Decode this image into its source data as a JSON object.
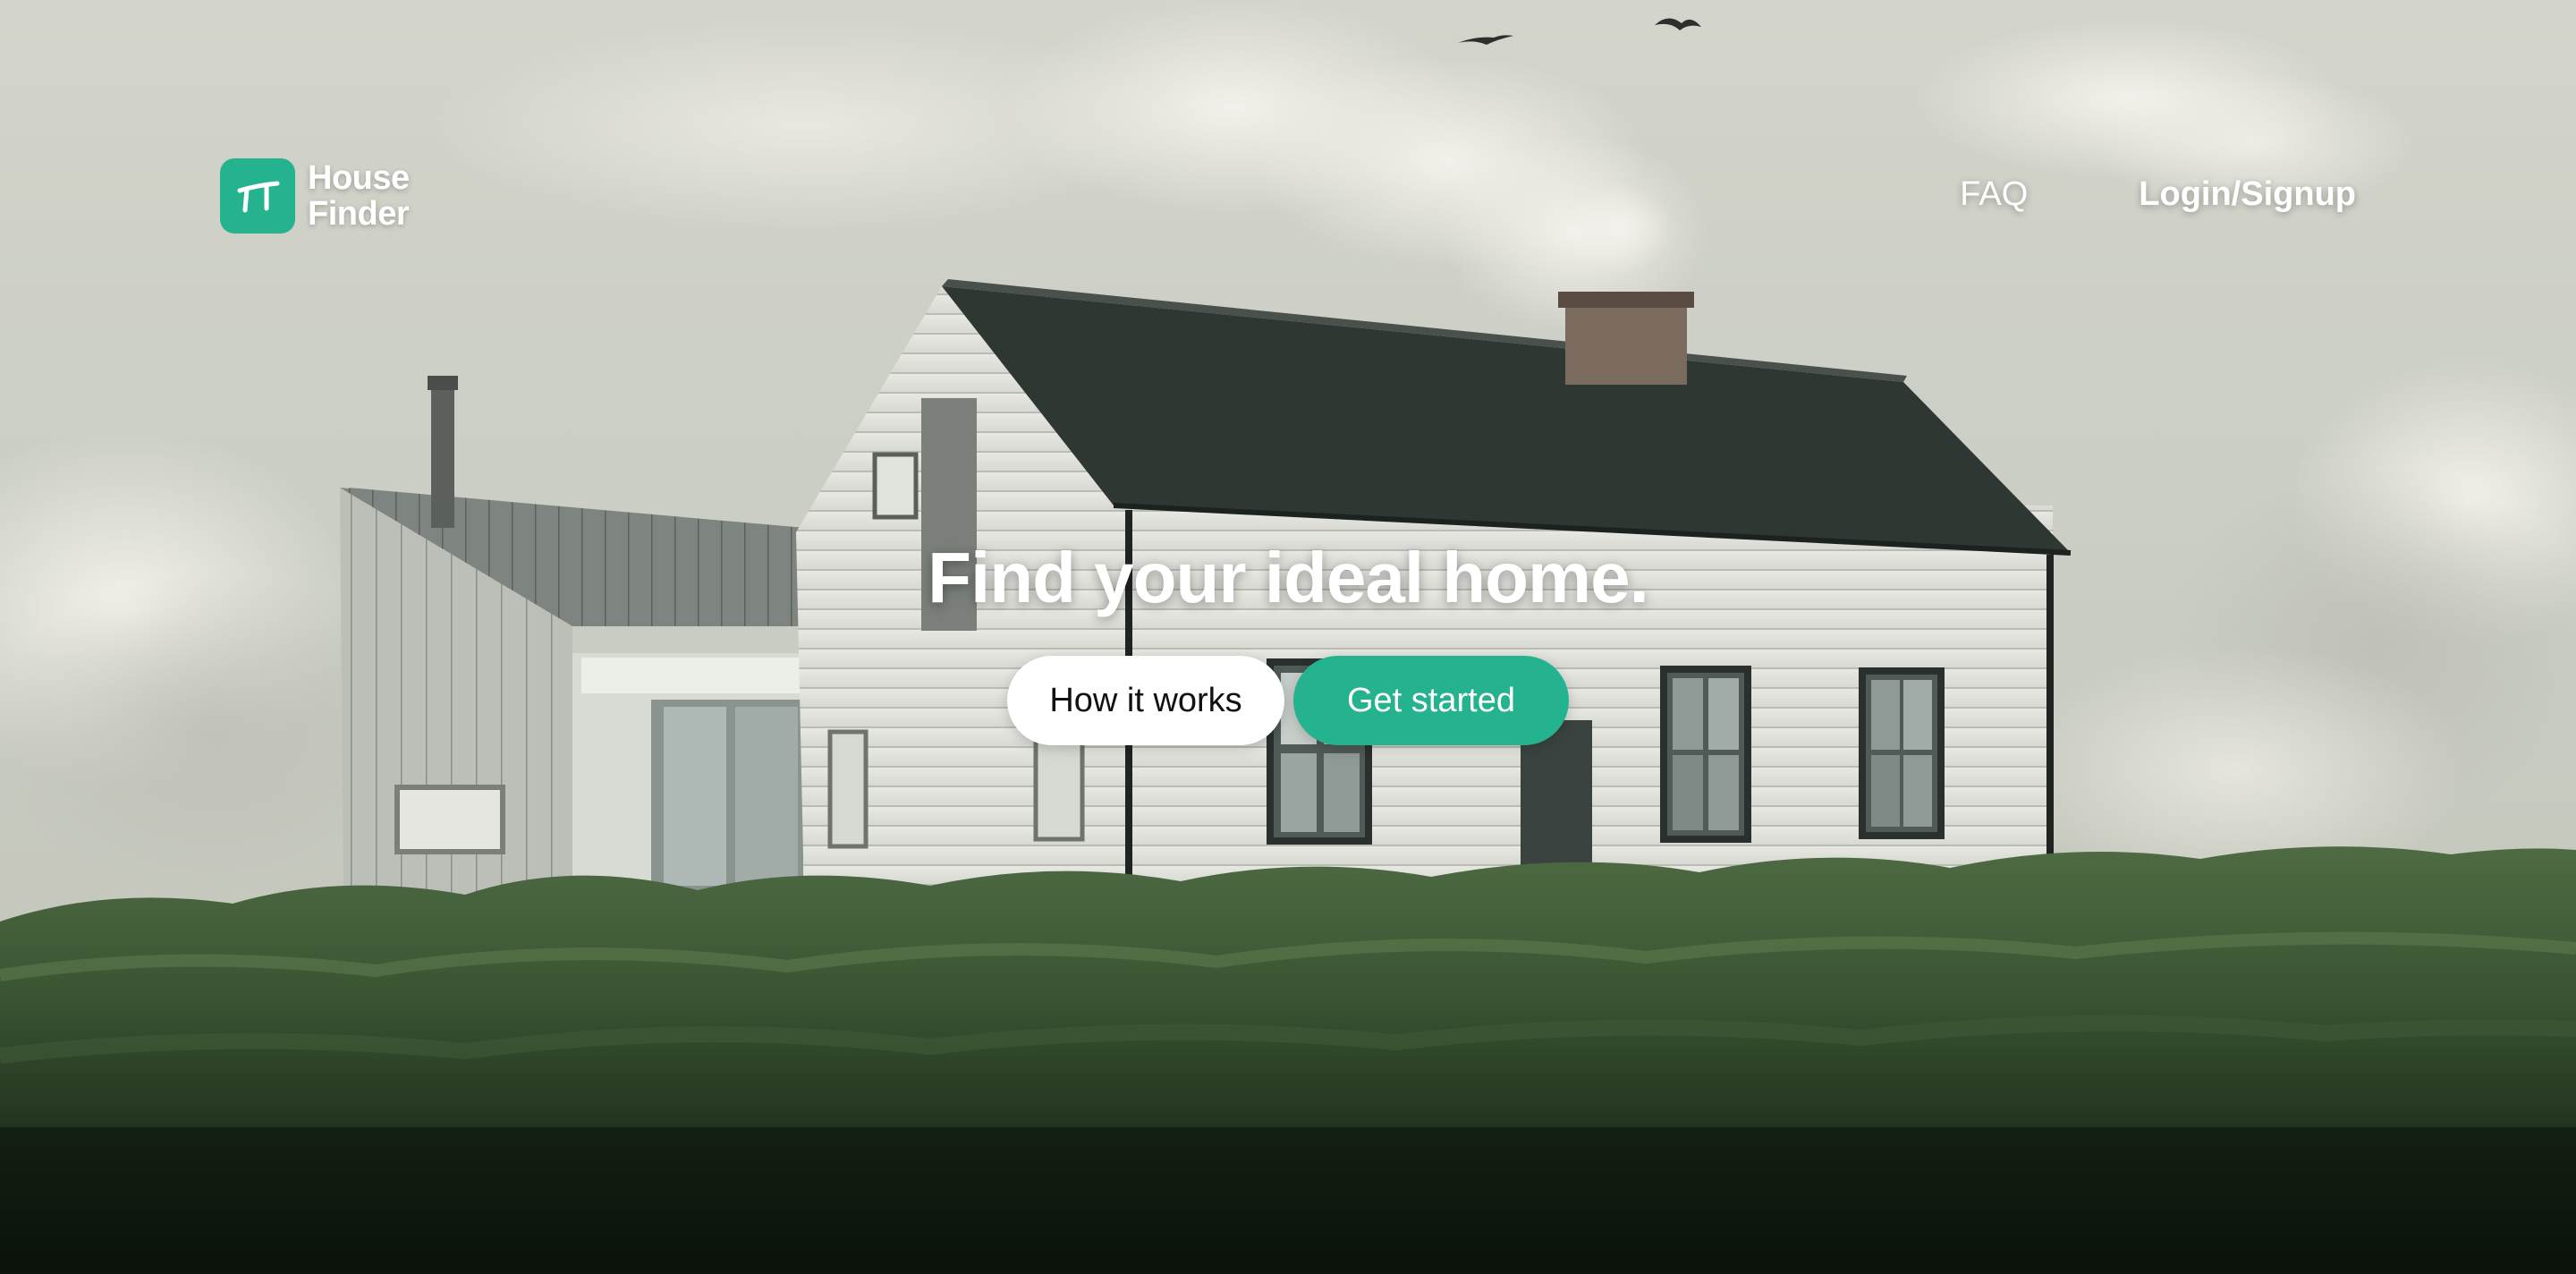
{
  "brand": {
    "name_line1": "House",
    "name_line2": "Finder",
    "accent_color": "#25b28f",
    "logo_icon": "h-monogram-icon"
  },
  "nav": {
    "faq_label": "FAQ",
    "login_label": "Login/Signup"
  },
  "hero": {
    "headline": "Find your ideal home.",
    "secondary_button_label": "How it works",
    "primary_button_label": "Get started",
    "background": "white-clapboard-house-in-grassy-dunes-photo"
  }
}
